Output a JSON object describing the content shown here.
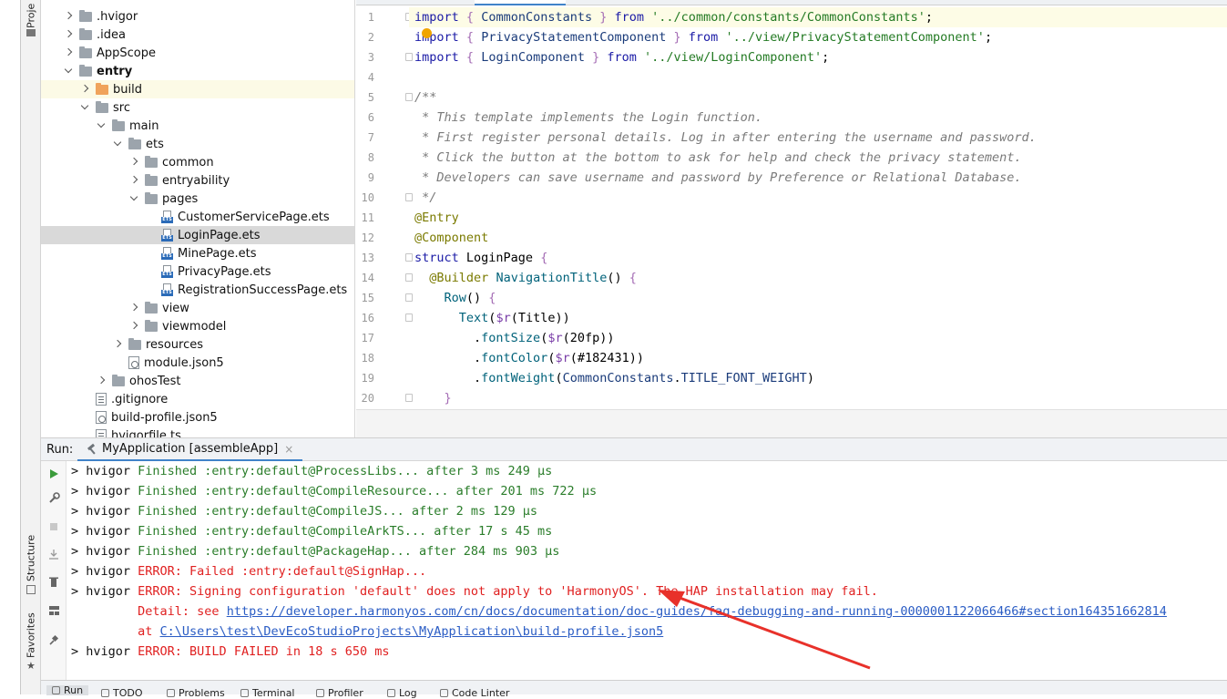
{
  "left_strip": {
    "project_tab": "Proje",
    "structure_tab": "Structure",
    "favorites_tab": "Favorites"
  },
  "tree": {
    "items": [
      {
        "label": ".hvigor",
        "depth": 1,
        "arrow": "right",
        "icon": "folder-icon"
      },
      {
        "label": ".idea",
        "depth": 1,
        "arrow": "right",
        "icon": "folder-icon"
      },
      {
        "label": "AppScope",
        "depth": 1,
        "arrow": "right",
        "icon": "folder-icon"
      },
      {
        "label": "entry",
        "depth": 1,
        "arrow": "down",
        "icon": "folder-icon",
        "bold": true
      },
      {
        "label": "build",
        "depth": 2,
        "arrow": "right",
        "icon": "folder-orange-icon",
        "highlight": "yellow"
      },
      {
        "label": "src",
        "depth": 2,
        "arrow": "down",
        "icon": "folder-icon"
      },
      {
        "label": "main",
        "depth": 3,
        "arrow": "down",
        "icon": "folder-icon"
      },
      {
        "label": "ets",
        "depth": 4,
        "arrow": "down",
        "icon": "folder-icon"
      },
      {
        "label": "common",
        "depth": 5,
        "arrow": "right",
        "icon": "folder-icon"
      },
      {
        "label": "entryability",
        "depth": 5,
        "arrow": "right",
        "icon": "folder-icon"
      },
      {
        "label": "pages",
        "depth": 5,
        "arrow": "down",
        "icon": "folder-icon"
      },
      {
        "label": "CustomerServicePage.ets",
        "depth": 6,
        "arrow": "none",
        "icon": "ets-file-icon"
      },
      {
        "label": "LoginPage.ets",
        "depth": 6,
        "arrow": "none",
        "icon": "ets-file-icon",
        "highlight": "selected"
      },
      {
        "label": "MinePage.ets",
        "depth": 6,
        "arrow": "none",
        "icon": "ets-file-icon"
      },
      {
        "label": "PrivacyPage.ets",
        "depth": 6,
        "arrow": "none",
        "icon": "ets-file-icon"
      },
      {
        "label": "RegistrationSuccessPage.ets",
        "depth": 6,
        "arrow": "none",
        "icon": "ets-file-icon"
      },
      {
        "label": "view",
        "depth": 5,
        "arrow": "right",
        "icon": "folder-icon"
      },
      {
        "label": "viewmodel",
        "depth": 5,
        "arrow": "right",
        "icon": "folder-icon"
      },
      {
        "label": "resources",
        "depth": 4,
        "arrow": "right",
        "icon": "folder-icon"
      },
      {
        "label": "module.json5",
        "depth": 4,
        "arrow": "none",
        "icon": "json-file-icon"
      },
      {
        "label": "ohosTest",
        "depth": 3,
        "arrow": "right",
        "icon": "folder-icon"
      },
      {
        "label": ".gitignore",
        "depth": 2,
        "arrow": "none",
        "icon": "text-file-icon"
      },
      {
        "label": "build-profile.json5",
        "depth": 2,
        "arrow": "none",
        "icon": "json-file-icon"
      },
      {
        "label": "hvigorfile.ts",
        "depth": 2,
        "arrow": "none",
        "icon": "text-file-icon"
      }
    ]
  },
  "editor": {
    "line_numbers": [
      "1",
      "2",
      "3",
      "4",
      "5",
      "6",
      "7",
      "8",
      "9",
      "10",
      "11",
      "12",
      "13",
      "14",
      "15",
      "16",
      "17",
      "18",
      "19",
      "20"
    ],
    "lines": [
      [
        {
          "t": "import",
          "c": "kw"
        },
        {
          "t": " "
        },
        {
          "t": "{",
          "c": "brace"
        },
        {
          "t": " CommonConstants ",
          "c": "id"
        },
        {
          "t": "}",
          "c": "brace"
        },
        {
          "t": " "
        },
        {
          "t": "from",
          "c": "kw"
        },
        {
          "t": " "
        },
        {
          "t": "'../common/constants/CommonConstants'",
          "c": "str"
        },
        {
          "t": ";"
        }
      ],
      [
        {
          "t": "import",
          "c": "kw"
        },
        {
          "t": " "
        },
        {
          "t": "{",
          "c": "brace"
        },
        {
          "t": " PrivacyStatementComponent ",
          "c": "id"
        },
        {
          "t": "}",
          "c": "brace"
        },
        {
          "t": " "
        },
        {
          "t": "from",
          "c": "kw"
        },
        {
          "t": " "
        },
        {
          "t": "'../view/PrivacyStatementComponent'",
          "c": "str"
        },
        {
          "t": ";"
        }
      ],
      [
        {
          "t": "import",
          "c": "kw"
        },
        {
          "t": " "
        },
        {
          "t": "{",
          "c": "brace"
        },
        {
          "t": " LoginComponent ",
          "c": "id"
        },
        {
          "t": "}",
          "c": "brace"
        },
        {
          "t": " "
        },
        {
          "t": "from",
          "c": "kw"
        },
        {
          "t": " "
        },
        {
          "t": "'../view/LoginComponent'",
          "c": "str"
        },
        {
          "t": ";"
        }
      ],
      [],
      [
        {
          "t": "/**",
          "c": "cm"
        }
      ],
      [
        {
          "t": " * This template implements the Login function.",
          "c": "cm"
        }
      ],
      [
        {
          "t": " * First register personal details. Log in after entering the username and password.",
          "c": "cm"
        }
      ],
      [
        {
          "t": " * Click the button at the bottom to ask for help and check the privacy statement.",
          "c": "cm"
        }
      ],
      [
        {
          "t": " * Developers can save username and password by Preference or Relational Database.",
          "c": "cm"
        }
      ],
      [
        {
          "t": " */",
          "c": "cm"
        }
      ],
      [
        {
          "t": "@Entry",
          "c": "ann"
        }
      ],
      [
        {
          "t": "@Component",
          "c": "ann"
        }
      ],
      [
        {
          "t": "struct",
          "c": "kw"
        },
        {
          "t": " LoginPage "
        },
        {
          "t": "{",
          "c": "brace"
        }
      ],
      [
        {
          "t": "  "
        },
        {
          "t": "@Builder",
          "c": "ann"
        },
        {
          "t": " "
        },
        {
          "t": "NavigationTitle",
          "c": "fn"
        },
        {
          "t": "() "
        },
        {
          "t": "{",
          "c": "brace"
        }
      ],
      [
        {
          "t": "    "
        },
        {
          "t": "Row",
          "c": "fn"
        },
        {
          "t": "() "
        },
        {
          "t": "{",
          "c": "brace"
        }
      ],
      [
        {
          "t": "      "
        },
        {
          "t": "Text",
          "c": "fn"
        },
        {
          "t": "("
        },
        {
          "t": "$r",
          "c": "res"
        },
        {
          "t": "(Title))"
        }
      ],
      [
        {
          "t": "        ."
        },
        {
          "t": "fontSize",
          "c": "fn"
        },
        {
          "t": "("
        },
        {
          "t": "$r",
          "c": "res"
        },
        {
          "t": "(20fp))"
        }
      ],
      [
        {
          "t": "        ."
        },
        {
          "t": "fontColor",
          "c": "fn"
        },
        {
          "t": "("
        },
        {
          "t": "$r",
          "c": "res"
        },
        {
          "t": "(#182431))"
        }
      ],
      [
        {
          "t": "        ."
        },
        {
          "t": "fontWeight",
          "c": "fn"
        },
        {
          "t": "("
        },
        {
          "t": "CommonConstants",
          "c": "id"
        },
        {
          "t": "."
        },
        {
          "t": "TITLE_FONT_WEIGHT",
          "c": "id"
        },
        {
          "t": ")"
        }
      ],
      [
        {
          "t": "    "
        },
        {
          "t": "}",
          "c": "brace"
        }
      ]
    ]
  },
  "run_panel": {
    "label": "Run:",
    "tab_title": "MyApplication [assembleApp]",
    "tab_close": "×",
    "console": [
      [
        {
          "t": "> hvigor "
        },
        {
          "t": "Finished :entry:default@ProcessLibs... after 3 ms 249 μs",
          "c": "ok"
        }
      ],
      [
        {
          "t": "> hvigor "
        },
        {
          "t": "Finished :entry:default@CompileResource... after 201 ms 722 μs",
          "c": "ok"
        }
      ],
      [
        {
          "t": "> hvigor "
        },
        {
          "t": "Finished :entry:default@CompileJS... after 2 ms 129 μs",
          "c": "ok"
        }
      ],
      [
        {
          "t": "> hvigor "
        },
        {
          "t": "Finished :entry:default@CompileArkTS... after 17 s 45 ms",
          "c": "ok"
        }
      ],
      [
        {
          "t": "> hvigor "
        },
        {
          "t": "Finished :entry:default@PackageHap... after 284 ms 903 μs",
          "c": "ok"
        }
      ],
      [
        {
          "t": "> hvigor "
        },
        {
          "t": "ERROR: Failed :entry:default@SignHap... ",
          "c": "err"
        }
      ],
      [
        {
          "t": "> hvigor "
        },
        {
          "t": "ERROR: Signing configuration 'default' does not apply to 'HarmonyOS'. The HAP installation may fail.",
          "c": "err"
        }
      ],
      [
        {
          "t": "         "
        },
        {
          "t": "Detail: see ",
          "c": "err"
        },
        {
          "t": "https://developer.harmonyos.com/cn/docs/documentation/doc-guides/faq-debugging-and-running-0000001122066466#section164351662814",
          "c": "link"
        }
      ],
      [
        {
          "t": "         "
        },
        {
          "t": "at ",
          "c": "err"
        },
        {
          "t": "C:\\Users\\test\\DevEcoStudioProjects\\MyApplication\\build-profile.json5",
          "c": "link"
        }
      ],
      [
        {
          "t": "> hvigor "
        },
        {
          "t": "ERROR: BUILD FAILED in 18 s 650 ms",
          "c": "err"
        }
      ]
    ]
  },
  "bottom_bar": {
    "items": [
      "Run",
      "TODO",
      "Problems",
      "Terminal",
      "Profiler",
      "Log",
      "Code Linter"
    ]
  },
  "colors": {
    "success": "#2a7d2a",
    "error": "#e02020",
    "link": "#2a5cc4",
    "annotation_arrow": "#e8312a"
  }
}
